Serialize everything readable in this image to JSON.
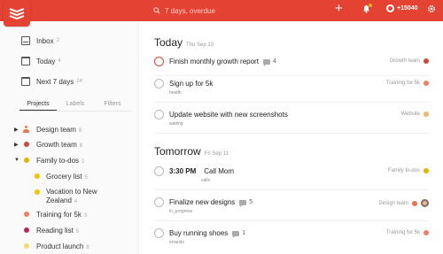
{
  "topbar": {
    "search_placeholder": "7 days, overdue",
    "karma": "+15040",
    "colors": {
      "bar": "#e44232",
      "accent_dot": "#f7b000"
    }
  },
  "sidebar": {
    "nav": [
      {
        "label": "Inbox",
        "count": "2",
        "icon": "inbox-icon"
      },
      {
        "label": "Today",
        "count": "4",
        "icon": "calendar-today-icon",
        "day": ""
      },
      {
        "label": "Next 7 days",
        "count": "24",
        "icon": "calendar-week-icon"
      }
    ],
    "tabs": [
      "Projects",
      "Labels",
      "Filters"
    ],
    "projects": [
      {
        "name": "Design team",
        "count": "8",
        "color": "#e8744f",
        "caret": "right",
        "shared": true
      },
      {
        "name": "Growth team",
        "count": "8",
        "color": "#c84a3a",
        "caret": "right"
      },
      {
        "name": "Family to-dos",
        "count": "1",
        "color": "#e0b400",
        "caret": "down"
      },
      {
        "name": "Grocery list",
        "count": "5",
        "color": "#f2c300",
        "indent": true
      },
      {
        "name": "Vacation to New",
        "name2": "Zealand",
        "count": "4",
        "color": "#f2c300",
        "indent": true
      },
      {
        "name": "Training for 5k",
        "count": "3",
        "color": "#f07f6a"
      },
      {
        "name": "Reading list",
        "count": "5",
        "color": "#b8255f"
      },
      {
        "name": "Product launch",
        "count": "8",
        "color": "#f2dc6a"
      }
    ]
  },
  "today": {
    "title": "Today",
    "date": "Thu Sep 10",
    "tasks": [
      {
        "text": "Finish monthly growth report",
        "comments": "4",
        "label": "",
        "project": "Growth team",
        "color": "#c84a3a",
        "priority": true
      },
      {
        "text": "Sign up for 5k",
        "comments": "",
        "label": "health",
        "project": "Training for 5k",
        "color": "#f07f6a"
      },
      {
        "text": "Update website with new screenshots",
        "comments": "",
        "label": "waiting",
        "project": "Website",
        "color": "#f2b66a"
      }
    ]
  },
  "tomorrow": {
    "title": "Tomorrow",
    "date": "Fri Sep 11",
    "tasks": [
      {
        "time": "3:30 PM",
        "text": "Call Mom",
        "comments": "",
        "label": "calls",
        "project": "Family to-dos",
        "color": "#e0b400"
      },
      {
        "text": "Finalize new designs",
        "comments": "5",
        "label": "in_progress",
        "project": "Design team",
        "color": "#e8744f",
        "avatar": true
      },
      {
        "text": "Buy running shoes",
        "comments": "1",
        "label": "errands",
        "project": "Training for 5k",
        "color": "#f07f6a"
      }
    ]
  }
}
